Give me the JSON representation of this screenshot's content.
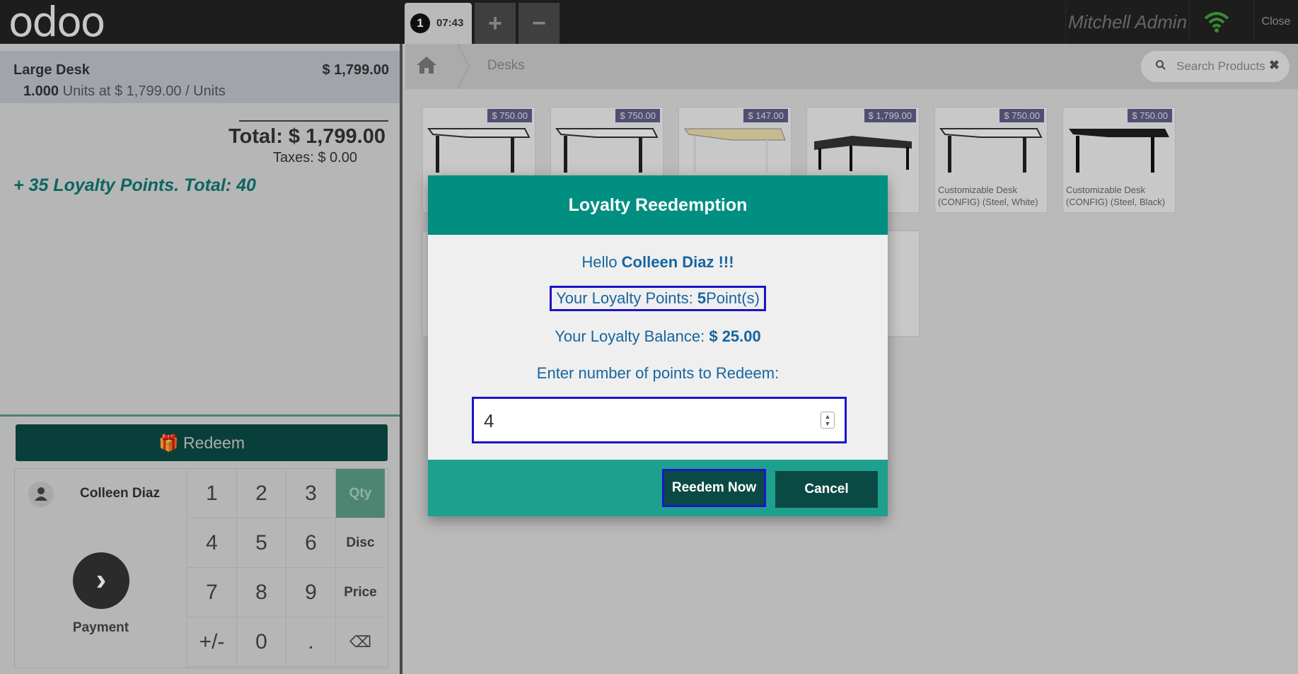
{
  "header": {
    "logo": "odoo",
    "order_number": "1",
    "order_time": "07:43",
    "add_label": "+",
    "remove_label": "−",
    "user": "Mitchell Admin",
    "close_label": "Close"
  },
  "order": {
    "line_name": "Large Desk",
    "line_price": "$ 1,799.00",
    "line_qty": "1.000",
    "line_detail": " Units at $ 1,799.00 / Units",
    "total": "Total: $ 1,799.00",
    "taxes": "Taxes: $ 0.00",
    "loyalty": "+ 35 Loyalty Points. Total: 40"
  },
  "actions": {
    "redeem_label": "Redeem",
    "customer_name": "Colleen Diaz",
    "payment_label": "Payment"
  },
  "numpad": {
    "keys": [
      "1",
      "2",
      "3",
      "Qty",
      "4",
      "5",
      "6",
      "Disc",
      "7",
      "8",
      "9",
      "Price",
      "+/-",
      "0",
      ".",
      "⌫"
    ]
  },
  "breadcrumb": {
    "category": "Desks"
  },
  "search": {
    "placeholder": "Search Products"
  },
  "products": [
    {
      "price": "$ 750.00",
      "name": ""
    },
    {
      "price": "$ 750.00",
      "name": ""
    },
    {
      "price": "$ 147.00",
      "name": ""
    },
    {
      "price": "$ 1,799.00",
      "name": ""
    },
    {
      "price": "$ 750.00",
      "name": "Customizable Desk (CONFIG) (Steel, White)"
    },
    {
      "price": "$ 750.00",
      "name": "Customizable Desk (CONFIG) (Steel, Black)"
    }
  ],
  "modal": {
    "title": "Loyalty Reedemption",
    "greeting_prefix": "Hello ",
    "greeting_name": "Colleen Diaz !!!",
    "points_prefix": "Your Loyalty Points: ",
    "points_value": "5",
    "points_suffix": "Point(s)",
    "balance_prefix": "Your Loyalty Balance: ",
    "balance_value": "$ 25.00",
    "enter_label": "Enter number of points to Redeem:",
    "points_input": "4",
    "redeem_now_label": "Reedem Now",
    "cancel_label": "Cancel"
  }
}
